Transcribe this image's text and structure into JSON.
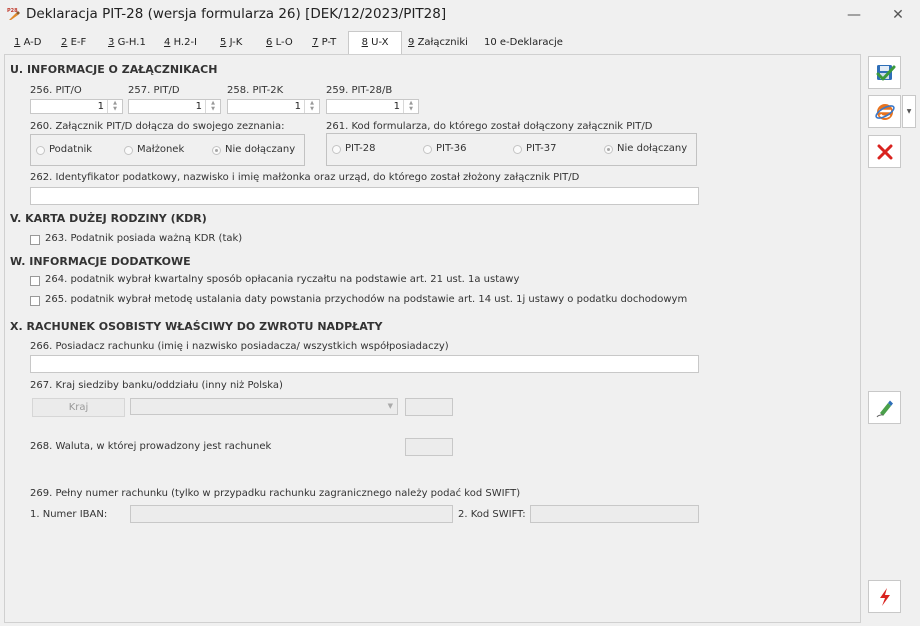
{
  "window": {
    "title": "Deklaracja PIT-28 (wersja formularza 26) [DEK/12/2023/PIT28]",
    "app_icon_text": "P28",
    "minimize": "—",
    "close": "✕"
  },
  "tabs": [
    {
      "num": "1",
      "label": "A-D"
    },
    {
      "num": "2",
      "label": "E-F"
    },
    {
      "num": "3",
      "label": "G-H.1"
    },
    {
      "num": "4",
      "label": "H.2-I"
    },
    {
      "num": "5",
      "label": "J-K"
    },
    {
      "num": "6",
      "label": "L-O"
    },
    {
      "num": "7",
      "label": "P-T"
    },
    {
      "num": "8",
      "label": "U-X"
    },
    {
      "num": "9",
      "label": "Załączniki"
    },
    {
      "num": "",
      "label": "10 e-Deklaracje"
    }
  ],
  "active_tab": "8",
  "section_u": {
    "heading": "U. INFORMACJE O ZAŁĄCZNIKACH",
    "fields": [
      {
        "label": "256. PIT/O",
        "value": "1"
      },
      {
        "label": "257. PIT/D",
        "value": "1"
      },
      {
        "label": "258. PIT-2K",
        "value": "1"
      },
      {
        "label": "259. PIT-28/B",
        "value": "1"
      }
    ],
    "f260": {
      "label": "260. Załącznik PIT/D dołącza do swojego zeznania:",
      "options": [
        "Podatnik",
        "Małżonek",
        "Nie dołączany"
      ],
      "selected": "Nie dołączany"
    },
    "f261": {
      "label": "261. Kod formularza, do którego został dołączony załącznik PIT/D",
      "options": [
        "PIT-28",
        "PIT-36",
        "PIT-37",
        "Nie dołączany"
      ],
      "selected": "Nie dołączany"
    },
    "f262": {
      "label": "262. Identyfikator podatkowy, nazwisko i imię małżonka oraz urząd, do którego został złożony załącznik PIT/D",
      "value": ""
    }
  },
  "section_v": {
    "heading": "V. KARTA DUŻEJ RODZINY (KDR)",
    "f263": {
      "label": "263. Podatnik posiada ważną KDR (tak)",
      "checked": false
    }
  },
  "section_w": {
    "heading": "W. INFORMACJE DODATKOWE",
    "f264": {
      "label": "264. podatnik wybrał kwartalny sposób opłacania ryczałtu na podstawie art. 21 ust. 1a ustawy",
      "checked": false
    },
    "f265": {
      "label": "265. podatnik wybrał metodę ustalania daty powstania przychodów na podstawie art. 14 ust. 1j ustawy o podatku dochodowym",
      "checked": false
    }
  },
  "section_x": {
    "heading": "X. RACHUNEK OSOBISTY WŁAŚCIWY DO ZWROTU NADPŁATY",
    "f266": {
      "label": "266. Posiadacz rachunku (imię i nazwisko posiadacza/ wszystkich współposiadaczy)",
      "value": ""
    },
    "f267": {
      "label": "267. Kraj siedziby banku/oddziału (inny niż Polska)",
      "button": "Kraj",
      "value": "",
      "code": ""
    },
    "f268": {
      "label": "268. Waluta, w której prowadzony jest rachunek",
      "value": ""
    },
    "f269": {
      "label": "269. Pełny numer rachunku (tylko w przypadku rachunku zagranicznego należy podać kod SWIFT)",
      "iban_label": "1. Numer IBAN:",
      "iban_value": "",
      "swift_label": "2. Kod SWIFT:",
      "swift_value": ""
    }
  },
  "sidebar": {
    "buttons": [
      "save-icon",
      "internet-explorer-icon",
      "cancel-icon",
      "edit-pen-icon",
      "lightning-icon"
    ],
    "colors": {
      "save_check": "#3c9a3c",
      "ie_orange": "#e8731e",
      "cancel_red": "#d9231f",
      "lightning_red": "#d9231f"
    }
  }
}
